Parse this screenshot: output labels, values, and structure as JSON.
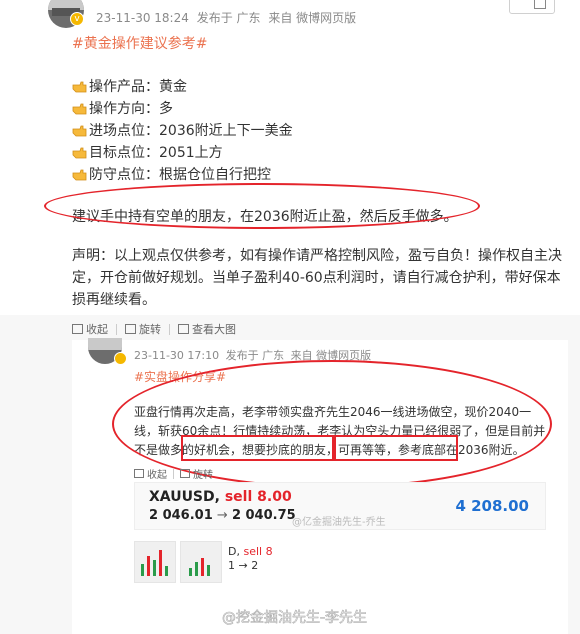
{
  "post": {
    "meta": {
      "time": "23-11-30 18:24",
      "posted_from": "发布于 广东",
      "source": "来自 微博网页版"
    },
    "hashtag": "#黄金操作建议参考#",
    "rows": [
      {
        "label": "操作产品：黄金"
      },
      {
        "label": "操作方向：多"
      },
      {
        "label": "进场点位：2036附近上下一美金"
      },
      {
        "label": "目标点位：2051上方"
      },
      {
        "label": "防守点位：根据仓位自行把控"
      }
    ],
    "highlight": "建议手中持有空单的朋友，在2036附近止盈，然后反手做多。",
    "declaration": "声明：以上观点仅供参考，如有操作请严格控制风险，盈亏自负！操作权自主决定，开仓前做好规划。当单子盈利40-60点利润时，请自行减仓护利，带好保本损再继续看。",
    "toolbar": {
      "collect": "收起",
      "rotate": "旋转",
      "view_large": "查看大图"
    }
  },
  "quoted": {
    "meta": {
      "time": "23-11-30 17:10",
      "posted_from": "发布于 广东",
      "source": "来自 微博网页版"
    },
    "hashtag": "#实盘操作分享#",
    "text_main": "亚盘行情再次走高，老李带领实盘齐先生2046一线进场做空，现价2040一线，斩获60余点！行情持续动荡，老李认为空头力量已经很弱了，但是目前并不是做多的好机会，",
    "text_box1": "想要抄底的朋友，可再等等，",
    "text_box2": "参考底部在2036附近。",
    "toolbar": {
      "collect": "收起",
      "rotate": "旋转"
    },
    "trade": {
      "symbol": "XAUUSD,",
      "side": "sell 8.00",
      "open_price": "2 046.01",
      "arrow": "→",
      "close_price": "2 040.75",
      "profit": "4 208.00"
    },
    "watermark": "@亿金掘油先生-乔生",
    "mini": {
      "line1": "D,",
      "line1_sell": "sell 8",
      "line2": "1 → 2"
    }
  },
  "bottom_watermark": "@挖金掘油先生-李先生",
  "colors": {
    "hashtag": "#eb7350",
    "annotation": "#e4242b",
    "profit": "#1f6fd1",
    "badge": "#f5b800"
  }
}
